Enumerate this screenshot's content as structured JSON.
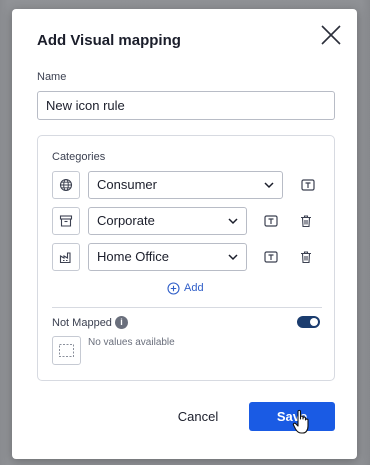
{
  "dialog": {
    "title": "Add Visual mapping",
    "name_label": "Name",
    "name_value": "New icon rule",
    "categories_label": "Categories",
    "rows": [
      {
        "icon": "globe-icon",
        "value": "Consumer"
      },
      {
        "icon": "archive-icon",
        "value": "Corporate"
      },
      {
        "icon": "factory-icon",
        "value": "Home Office"
      }
    ],
    "add_label": "Add",
    "not_mapped_label": "Not Mapped",
    "not_mapped_toggle": true,
    "empty_text": "No values available",
    "cancel_label": "Cancel",
    "save_label": "Save"
  },
  "colors": {
    "primary": "#1a5be4",
    "toggle_on": "#1b3c6e",
    "link": "#2f5ec8"
  }
}
